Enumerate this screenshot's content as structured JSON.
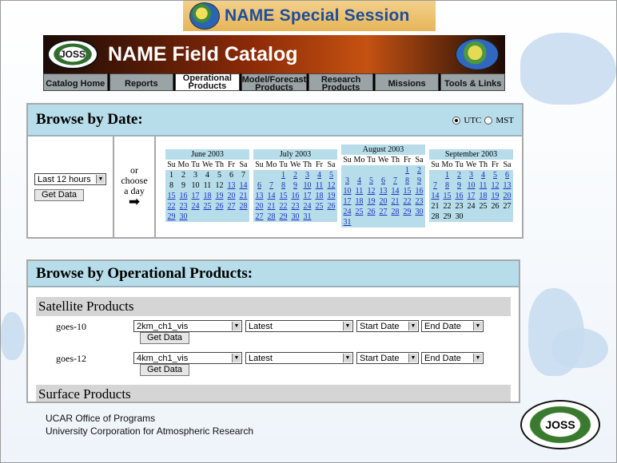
{
  "session_title": "NAME Special Session",
  "catalog": {
    "title": "NAME Field Catalog",
    "logo_left_text": "JOSS",
    "tabs": [
      {
        "label": "Catalog Home"
      },
      {
        "label": "Reports"
      },
      {
        "label": "Operational Products"
      },
      {
        "label": "Model/Forecast Products"
      },
      {
        "label": "Research Products"
      },
      {
        "label": "Missions"
      },
      {
        "label": "Tools & Links"
      }
    ]
  },
  "browse_date": {
    "heading": "Browse by Date:",
    "tz_utc": "UTC",
    "tz_mst": "MST",
    "period_select": "Last 12 hours",
    "get_data": "Get Data",
    "or_text": "or",
    "choose_text": "choose",
    "a_day_text": "a day",
    "arrow": "➡"
  },
  "calendars": [
    {
      "month": "June 2003",
      "dow": [
        "Su",
        "Mo",
        "Tu",
        "We",
        "Th",
        "Fr",
        "Sa"
      ],
      "weeks": [
        [
          "1",
          "2",
          "3",
          "4",
          "5",
          "6",
          "7"
        ],
        [
          "8",
          "9",
          "10",
          "11",
          "12",
          "13",
          "14"
        ],
        [
          "15",
          "16",
          "17",
          "18",
          "19",
          "20",
          "21"
        ],
        [
          "22",
          "23",
          "24",
          "25",
          "26",
          "27",
          "28"
        ],
        [
          "29",
          "30",
          "",
          "",
          "",
          "",
          ""
        ]
      ]
    },
    {
      "month": "July 2003",
      "dow": [
        "Su",
        "Mo",
        "Tu",
        "We",
        "Th",
        "Fr",
        "Sa"
      ],
      "weeks": [
        [
          "",
          "",
          "1",
          "2",
          "3",
          "4",
          "5"
        ],
        [
          "6",
          "7",
          "8",
          "9",
          "10",
          "11",
          "12"
        ],
        [
          "13",
          "14",
          "15",
          "16",
          "17",
          "18",
          "19"
        ],
        [
          "20",
          "21",
          "22",
          "23",
          "24",
          "25",
          "26"
        ],
        [
          "27",
          "28",
          "29",
          "30",
          "31",
          "",
          ""
        ]
      ]
    },
    {
      "month": "August 2003",
      "dow": [
        "Su",
        "Mo",
        "Tu",
        "We",
        "Th",
        "Fr",
        "Sa"
      ],
      "weeks": [
        [
          "",
          "",
          "",
          "",
          "",
          "1",
          "2"
        ],
        [
          "3",
          "4",
          "5",
          "6",
          "7",
          "8",
          "9"
        ],
        [
          "10",
          "11",
          "12",
          "13",
          "14",
          "15",
          "16"
        ],
        [
          "17",
          "18",
          "19",
          "20",
          "21",
          "22",
          "23"
        ],
        [
          "24",
          "25",
          "26",
          "27",
          "28",
          "29",
          "30"
        ],
        [
          "31",
          "",
          "",
          "",
          "",
          "",
          ""
        ]
      ]
    },
    {
      "month": "September 2003",
      "dow": [
        "Su",
        "Mo",
        "Tu",
        "We",
        "Th",
        "Fr",
        "Sa"
      ],
      "weeks": [
        [
          "",
          "1",
          "2",
          "3",
          "4",
          "5",
          "6"
        ],
        [
          "7",
          "8",
          "9",
          "10",
          "11",
          "12",
          "13"
        ],
        [
          "14",
          "15",
          "16",
          "17",
          "18",
          "19",
          "20"
        ],
        [
          "21",
          "22",
          "23",
          "24",
          "25",
          "26",
          "27"
        ],
        [
          "28",
          "29",
          "30",
          "",
          "",
          "",
          ""
        ]
      ]
    }
  ],
  "linked_days": {
    "June 2003": [
      "13",
      "14",
      "15",
      "16",
      "17",
      "18",
      "19",
      "20",
      "21",
      "22",
      "23",
      "24",
      "25",
      "26",
      "27",
      "28",
      "29",
      "30"
    ],
    "July 2003": [
      "1",
      "2",
      "3",
      "4",
      "5",
      "6",
      "7",
      "8",
      "9",
      "10",
      "11",
      "12",
      "13",
      "14",
      "15",
      "16",
      "17",
      "18",
      "19",
      "20",
      "21",
      "22",
      "23",
      "24",
      "25",
      "26",
      "27",
      "28",
      "29",
      "30",
      "31"
    ],
    "August 2003": [
      "1",
      "2",
      "3",
      "4",
      "5",
      "6",
      "7",
      "8",
      "9",
      "10",
      "11",
      "12",
      "13",
      "14",
      "15",
      "16",
      "17",
      "18",
      "19",
      "20",
      "21",
      "22",
      "23",
      "24",
      "25",
      "26",
      "27",
      "28",
      "29",
      "30",
      "31"
    ],
    "September 2003": [
      "1",
      "2",
      "3",
      "4",
      "5",
      "6",
      "7",
      "8",
      "9",
      "10",
      "11",
      "12",
      "13",
      "14",
      "15",
      "16",
      "17",
      "18",
      "19",
      "20"
    ]
  },
  "browse_ops": {
    "heading": "Browse by Operational Products:",
    "satellite_heading": "Satellite Products",
    "surface_heading": "Surface Products",
    "rows": [
      {
        "label": "goes-10",
        "product": "2km_ch1_vis",
        "time": "Latest",
        "start": "Start Date",
        "end": "End Date",
        "button": "Get Data"
      },
      {
        "label": "goes-12",
        "product": "4km_ch1_vis",
        "time": "Latest",
        "start": "Start Date",
        "end": "End Date",
        "button": "Get Data"
      }
    ]
  },
  "footer": {
    "line1": "UCAR Office of Programs",
    "line2": "University Corporation for Atmospheric Research",
    "logo_text": "JOSS"
  }
}
